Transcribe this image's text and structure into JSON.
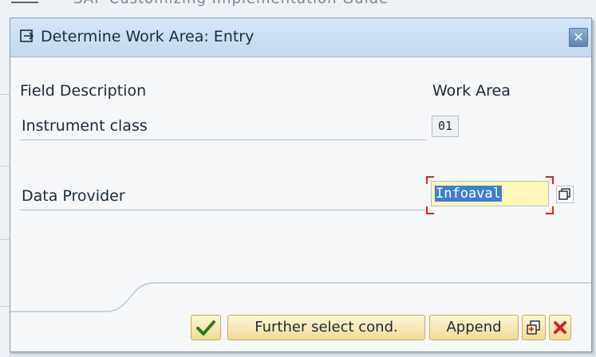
{
  "background": {
    "text": "SAP Customizing Implementation Guide"
  },
  "dialog": {
    "title": "Determine Work Area: Entry",
    "close_icon": "close-icon"
  },
  "headers": {
    "field_description": "Field Description",
    "work_area": "Work Area"
  },
  "rows": [
    {
      "label": "Instrument class",
      "value": "01"
    },
    {
      "label": "Data Provider",
      "value": "Infoaval"
    }
  ],
  "buttons": {
    "continue_icon": "checkmark-icon",
    "further_select": "Further select cond.",
    "append": "Append",
    "multiple_selection_icon": "multiple-selection-icon",
    "cancel_icon": "cancel-icon"
  },
  "colors": {
    "title_bar": "#c7dcf0",
    "input_highlight": "#fff6b8",
    "button": "#f6e8b3",
    "required_marker": "#d9262b"
  }
}
